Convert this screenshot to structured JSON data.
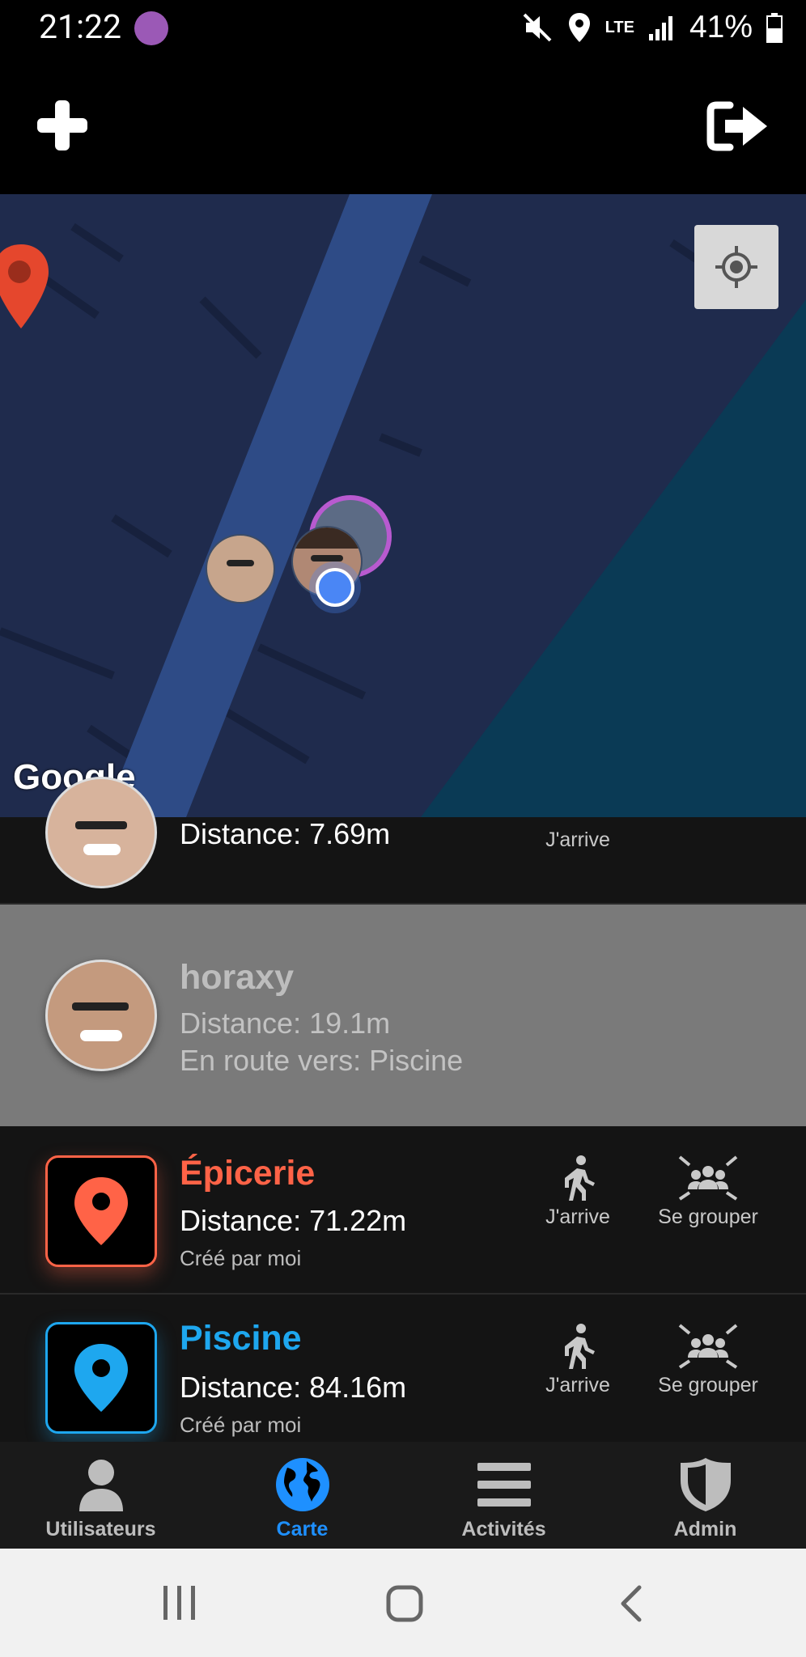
{
  "status_bar": {
    "time": "21:22",
    "network": "LTE",
    "battery": "41%",
    "icons": [
      "sticker-icon",
      "mute-icon",
      "location-icon",
      "lte-icon",
      "signal-icon",
      "battery-icon"
    ]
  },
  "header": {
    "icons": [
      "add-icon",
      "logout-icon"
    ]
  },
  "map": {
    "watermark": "Google",
    "icons": [
      "my-location-icon",
      "map-pin-icon"
    ]
  },
  "list": {
    "rows": [
      {
        "distance": "Distance: 7.69m",
        "action_label": "J'arrive"
      },
      {
        "name": "horaxy",
        "distance": "Distance: 19.1m",
        "route": "En route vers: Piscine"
      },
      {
        "name": "Épicerie",
        "distance": "Distance: 71.22m",
        "created": "Créé par moi",
        "action1": "J'arrive",
        "action2": "Se grouper",
        "accent": "#ff6347"
      },
      {
        "name": "Piscine",
        "distance": "Distance: 84.16m",
        "created": "Créé par moi",
        "action1": "J'arrive",
        "action2": "Se grouper",
        "accent": "#1ea7ef"
      }
    ]
  },
  "bottom_nav": {
    "items": [
      {
        "label": "Utilisateurs",
        "icon": "user-icon"
      },
      {
        "label": "Carte",
        "icon": "globe-icon",
        "active": true
      },
      {
        "label": "Activités",
        "icon": "menu-icon"
      },
      {
        "label": "Admin",
        "icon": "shield-icon"
      }
    ],
    "active_color": "#1e90ff",
    "inactive_color": "#bdbdbd"
  },
  "system_nav": {
    "icons": [
      "recents-icon",
      "home-icon",
      "back-icon"
    ]
  }
}
